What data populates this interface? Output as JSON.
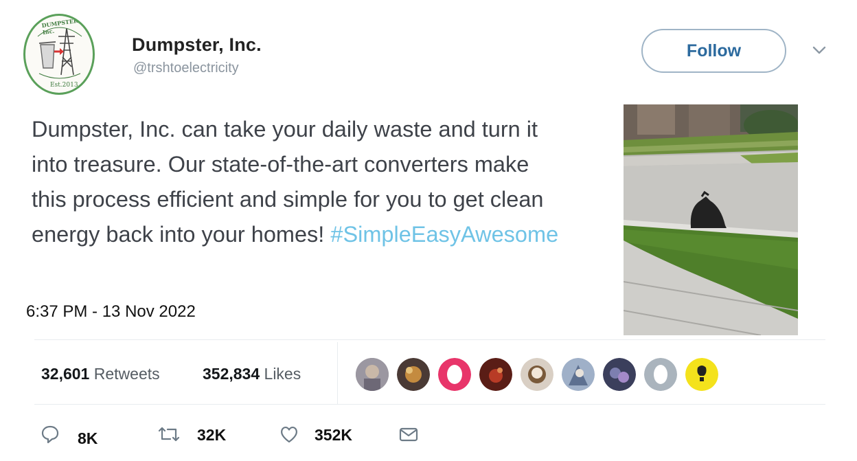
{
  "author": {
    "display_name": "Dumpster, Inc.",
    "handle": "@trshtoelectricity",
    "avatar_logo_text": "DUMPSTER, Inc.",
    "avatar_logo_subtext": "Est.2013"
  },
  "follow_button": {
    "label": "Follow"
  },
  "tweet": {
    "text": "Dumpster, Inc. can take your daily waste and turn it into treasure. Our state-of-the-art converters make this process efficient and simple for you to get clean energy back into your homes! ",
    "hashtag": "#SimpleEasyAwesome",
    "timestamp": "6:37 PM - 13 Nov 2022"
  },
  "stats": {
    "retweets_count": "32,601",
    "retweets_label": "Retweets",
    "likes_count": "352,834",
    "likes_label": "Likes"
  },
  "likers": [
    "avatar-1",
    "avatar-2",
    "avatar-3",
    "avatar-4",
    "avatar-5",
    "avatar-6",
    "avatar-7",
    "avatar-8",
    "avatar-9"
  ],
  "actions": {
    "reply_count": "8K",
    "retweet_count": "32K",
    "like_count": "352K"
  },
  "icons": [
    "chevron-down-icon",
    "reply-icon",
    "retweet-icon",
    "heart-icon",
    "envelope-icon"
  ],
  "colors": {
    "hashtag": "#6fc3e6",
    "follow_text": "#2c6a9e",
    "avatar_ring": "#5aa05a"
  }
}
